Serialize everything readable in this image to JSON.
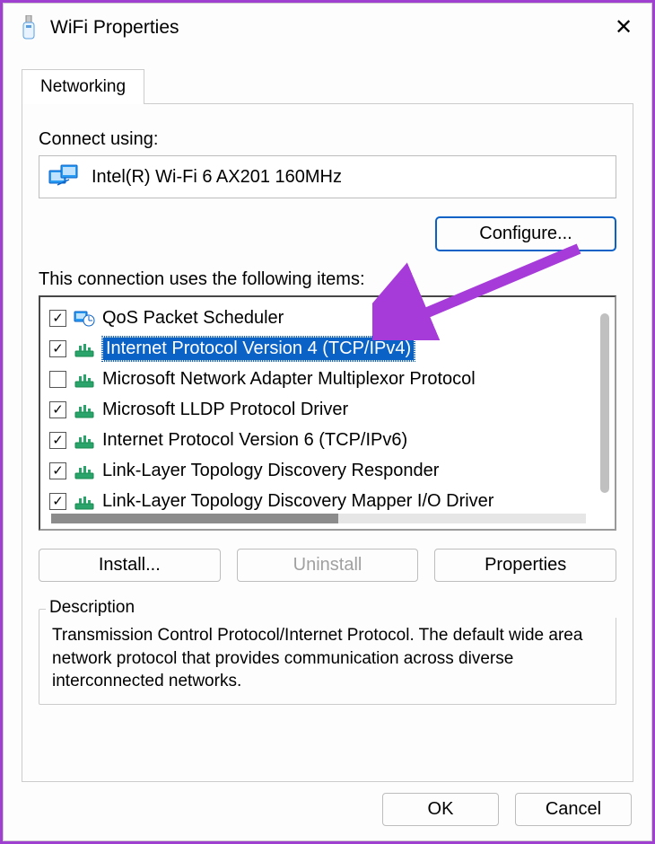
{
  "window": {
    "title": "WiFi Properties"
  },
  "tab": {
    "label": "Networking"
  },
  "connect": {
    "label": "Connect using:",
    "adapter": "Intel(R) Wi-Fi 6 AX201 160MHz",
    "configure_button": "Configure..."
  },
  "items_label": "This connection uses the following items:",
  "items": [
    {
      "checked": true,
      "icon": "qos",
      "label": "QoS Packet Scheduler",
      "selected": false
    },
    {
      "checked": true,
      "icon": "proto",
      "label": "Internet Protocol Version 4 (TCP/IPv4)",
      "selected": true
    },
    {
      "checked": false,
      "icon": "proto",
      "label": "Microsoft Network Adapter Multiplexor Protocol",
      "selected": false
    },
    {
      "checked": true,
      "icon": "proto",
      "label": "Microsoft LLDP Protocol Driver",
      "selected": false
    },
    {
      "checked": true,
      "icon": "proto",
      "label": "Internet Protocol Version 6 (TCP/IPv6)",
      "selected": false
    },
    {
      "checked": true,
      "icon": "proto",
      "label": "Link-Layer Topology Discovery Responder",
      "selected": false
    },
    {
      "checked": true,
      "icon": "proto",
      "label": "Link-Layer Topology Discovery Mapper I/O Driver",
      "selected": false
    }
  ],
  "buttons": {
    "install": "Install...",
    "uninstall": "Uninstall",
    "properties": "Properties"
  },
  "description": {
    "label": "Description",
    "text": "Transmission Control Protocol/Internet Protocol. The default wide area network protocol that provides communication across diverse interconnected networks."
  },
  "dialog_buttons": {
    "ok": "OK",
    "cancel": "Cancel"
  },
  "annotation": {
    "color": "#a63bd9"
  }
}
